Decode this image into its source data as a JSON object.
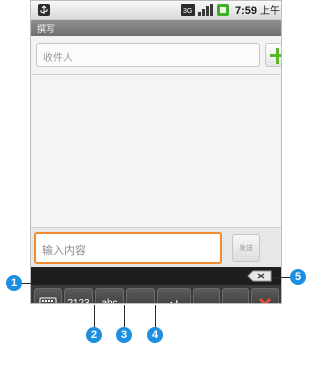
{
  "status_bar": {
    "time": "7:59",
    "ampm": "上午"
  },
  "screen": {
    "title": "撰写",
    "recipient_placeholder": "收件人",
    "compose_placeholder": "输入内容",
    "send_label": "发送"
  },
  "keyboard": {
    "keys": [
      {
        "name": "keyboard-switch-key",
        "label": ""
      },
      {
        "name": "numbers-key",
        "label": "?123"
      },
      {
        "name": "abc-key",
        "label": "abc"
      },
      {
        "name": "space-key",
        "label": "␣"
      },
      {
        "name": "enter-key",
        "label": "↵"
      },
      {
        "name": "comma-key",
        "label": ","
      },
      {
        "name": "period-key",
        "label": "。"
      },
      {
        "name": "settings-key",
        "label": ""
      }
    ]
  },
  "callouts": {
    "c1": "1",
    "c2": "2",
    "c3": "3",
    "c4": "4",
    "c5": "5"
  },
  "colors": {
    "accent_orange": "#f28a2e",
    "plus_green": "#58b82a",
    "callout_blue": "#1d8fe0",
    "settings_red": "#e64a3b"
  }
}
